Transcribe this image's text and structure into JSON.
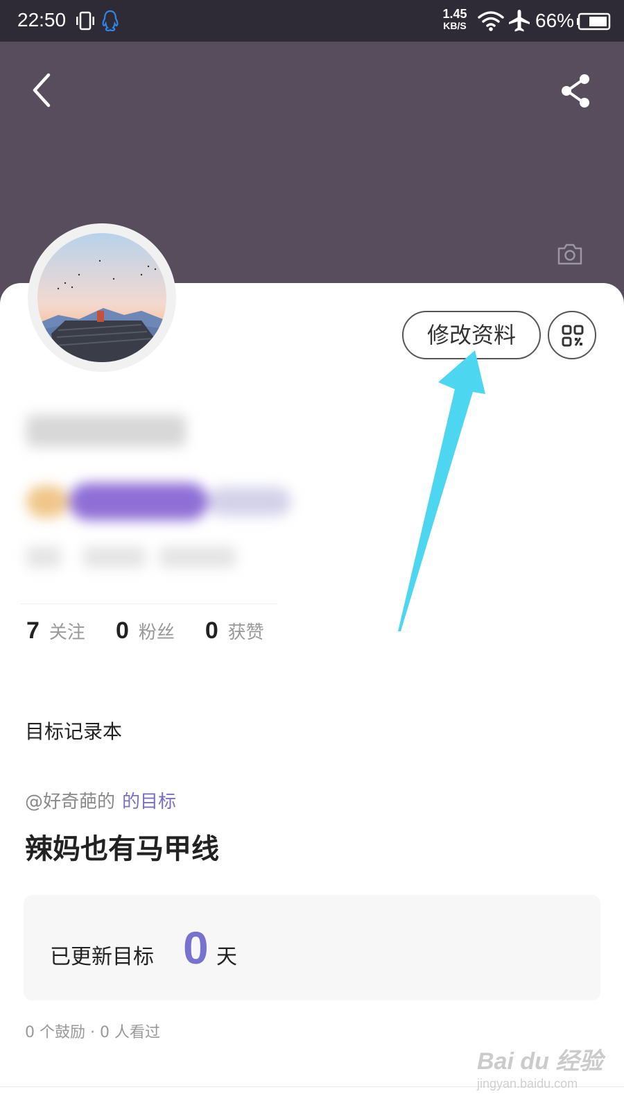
{
  "status_bar": {
    "time": "22:50",
    "net_speed_value": "1.45",
    "net_speed_unit": "KB/S",
    "battery_pct": "66%"
  },
  "profile": {
    "edit_label": "修改资料",
    "stats": [
      {
        "num": "7",
        "label": "关注"
      },
      {
        "num": "0",
        "label": "粉丝"
      },
      {
        "num": "0",
        "label": "获赞"
      }
    ]
  },
  "goal_section": {
    "title": "目标记录本",
    "owner_prefix": "@好奇葩的",
    "owner_suffix": "的目标",
    "goal_title": "辣妈也有马甲线",
    "updated_label": "已更新目标",
    "updated_days": "0",
    "updated_unit": "天",
    "meta": "0  个鼓励 · 0  人看过"
  },
  "watermark": {
    "brand": "Bai du 经验",
    "url": "jingyan.baidu.com"
  },
  "colors": {
    "header_bg": "#574d5d",
    "status_bg": "#2f2b36",
    "accent": "#7771cf",
    "arrow": "#4dd6f0"
  },
  "icons": [
    "vibrate-icon",
    "qq-icon",
    "wifi-icon",
    "airplane-icon",
    "battery-icon",
    "back-arrow-icon",
    "share-icon",
    "camera-icon",
    "qrcode-icon"
  ]
}
